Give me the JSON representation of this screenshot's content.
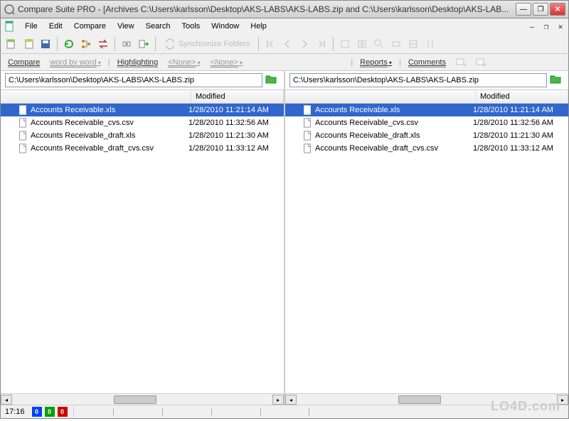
{
  "title": "Compare Suite PRO - [Archives C:\\Users\\karlsson\\Desktop\\AKS-LABS\\AKS-LABS.zip and C:\\Users\\karlsson\\Desktop\\AKS-LAB...",
  "menu": [
    "File",
    "Edit",
    "Compare",
    "View",
    "Search",
    "Tools",
    "Window",
    "Help"
  ],
  "toolbar": {
    "sync_folders": "Synchronize Folders"
  },
  "options": {
    "compare": "Compare",
    "word_by_word": "word by word",
    "highlighting": "Highlighting",
    "none1": "<None>",
    "none2": "<None>",
    "reports": "Reports",
    "comments": "Comments"
  },
  "panes": [
    {
      "path": "C:\\Users\\karlsson\\Desktop\\AKS-LABS\\AKS-LABS.zip",
      "columns": {
        "name": "",
        "modified": "Modified"
      },
      "files": [
        {
          "name": "Accounts Receivable.xls",
          "modified": "1/28/2010 11:21:14 AM",
          "selected": true
        },
        {
          "name": "Accounts Receivable_cvs.csv",
          "modified": "1/28/2010 11:32:56 AM",
          "selected": false
        },
        {
          "name": "Accounts Receivable_draft.xls",
          "modified": "1/28/2010 11:21:30 AM",
          "selected": false
        },
        {
          "name": "Accounts Receivable_draft_cvs.csv",
          "modified": "1/28/2010 11:33:12 AM",
          "selected": false
        }
      ]
    },
    {
      "path": "C:\\Users\\karlsson\\Desktop\\AKS-LABS\\AKS-LABS.zip",
      "columns": {
        "name": "",
        "modified": "Modified"
      },
      "files": [
        {
          "name": "Accounts Receivable.xls",
          "modified": "1/28/2010 11:21:14 AM",
          "selected": true
        },
        {
          "name": "Accounts Receivable_cvs.csv",
          "modified": "1/28/2010 11:32:56 AM",
          "selected": false
        },
        {
          "name": "Accounts Receivable_draft.xls",
          "modified": "1/28/2010 11:21:30 AM",
          "selected": false
        },
        {
          "name": "Accounts Receivable_draft_cvs.csv",
          "modified": "1/28/2010 11:33:12 AM",
          "selected": false
        }
      ]
    }
  ],
  "status": {
    "time": "17:16",
    "diffs": [
      "0",
      "0",
      "0"
    ]
  },
  "watermark": "LO4D.com"
}
